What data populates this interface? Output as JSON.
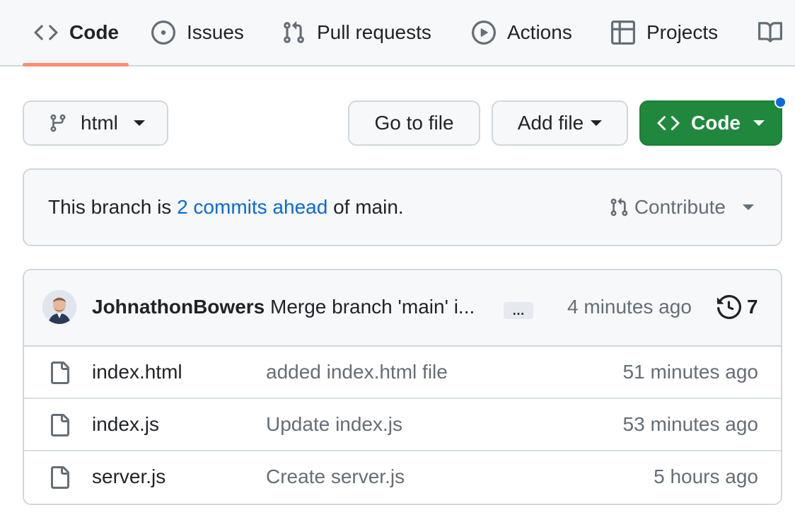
{
  "nav": {
    "tabs": [
      {
        "label": "Code",
        "icon": "code-icon",
        "active": true
      },
      {
        "label": "Issues",
        "icon": "issue-opened-icon",
        "active": false
      },
      {
        "label": "Pull requests",
        "icon": "git-pull-request-icon",
        "active": false
      },
      {
        "label": "Actions",
        "icon": "play-icon",
        "active": false
      },
      {
        "label": "Projects",
        "icon": "table-icon",
        "active": false
      },
      {
        "label": "",
        "icon": "book-icon",
        "active": false
      }
    ],
    "active_color": "#fd8c73"
  },
  "toolbar": {
    "branch_label": "html",
    "goto_label": "Go to file",
    "addfile_label": "Add file",
    "code_label": "Code",
    "code_color": "#1f883d",
    "notification_color": "#0969da"
  },
  "banner": {
    "prefix": "This branch is ",
    "link": "2 commits ahead",
    "suffix": " of main.",
    "contribute_label": "Contribute"
  },
  "latest_commit": {
    "author": "JohnathonBowers",
    "message": "Merge branch 'main' i...",
    "ellipsis": "…",
    "time": "4 minutes ago",
    "commit_count": "7"
  },
  "files": [
    {
      "name": "index.html",
      "message": "added index.html file",
      "time": "51 minutes ago"
    },
    {
      "name": "index.js",
      "message": "Update index.js",
      "time": "53 minutes ago"
    },
    {
      "name": "server.js",
      "message": "Create server.js",
      "time": "5 hours ago"
    }
  ],
  "colors": {
    "link": "#0969da",
    "muted": "#656d76",
    "border": "#d0d7de",
    "subtle_bg": "#f6f8fa"
  }
}
